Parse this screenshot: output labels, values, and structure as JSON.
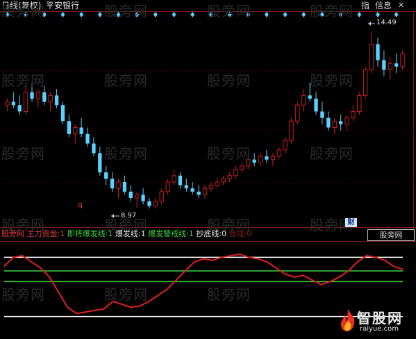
{
  "header": {
    "chart_type_label": "日线(复权)",
    "stock_name": "平安银行",
    "btn_guide": "指",
    "btn_info": "信息",
    "btn_close": "✕"
  },
  "annotations": {
    "high_label": "14.49",
    "low_label": "8.97",
    "q_marker": "q",
    "cai_marker": "财"
  },
  "indicator_legend": {
    "name": "股旁网",
    "items": [
      {
        "label": "主力资金:",
        "value": "1",
        "color": "#e23c3c"
      },
      {
        "label": "即将爆发线:",
        "value": "1",
        "color": "#3fd13f"
      },
      {
        "label": "爆发线:",
        "value": "1",
        "color": "#e8e8e8"
      },
      {
        "label": "爆发警戒线:",
        "value": "1",
        "color": "#3fd13f"
      },
      {
        "label": "抄底线:",
        "value": "0",
        "color": "#e8e8e8"
      },
      {
        "label": "合成:",
        "value": "0",
        "color": "#8a2020"
      }
    ]
  },
  "indicator_tab": "股旁网",
  "watermark_text": "股旁网",
  "logo": {
    "name": "智股网",
    "url": "raiyue.com"
  },
  "colors": {
    "up": "#c81e1e",
    "down": "#5ad2ff",
    "diamond": "#5ad2ff",
    "line_main": "#e02020",
    "line_white": "#ffffff",
    "line_green": "#3fd13f"
  },
  "chart_data": {
    "type": "candlestick",
    "high": 14.49,
    "low": 8.97,
    "ylim": [
      8.5,
      15.0
    ],
    "candles": [
      [
        12.2,
        12.4,
        12.0,
        12.3
      ],
      [
        12.3,
        12.6,
        12.1,
        12.2
      ],
      [
        12.2,
        12.5,
        11.9,
        12.0
      ],
      [
        12.0,
        12.8,
        11.9,
        12.6
      ],
      [
        12.6,
        12.9,
        12.3,
        12.4
      ],
      [
        12.4,
        12.7,
        12.1,
        12.6
      ],
      [
        12.6,
        12.8,
        12.2,
        12.3
      ],
      [
        12.3,
        12.6,
        12.0,
        12.5
      ],
      [
        12.5,
        12.7,
        12.1,
        12.2
      ],
      [
        12.2,
        12.3,
        11.6,
        11.7
      ],
      [
        11.7,
        11.9,
        11.2,
        11.3
      ],
      [
        11.3,
        11.6,
        11.0,
        11.5
      ],
      [
        11.5,
        11.8,
        11.2,
        11.3
      ],
      [
        11.3,
        11.5,
        10.9,
        11.0
      ],
      [
        11.0,
        11.2,
        10.6,
        10.7
      ],
      [
        10.7,
        10.9,
        10.0,
        10.1
      ],
      [
        10.1,
        10.3,
        9.7,
        9.9
      ],
      [
        9.9,
        10.1,
        9.5,
        9.6
      ],
      [
        9.6,
        9.9,
        9.3,
        9.8
      ],
      [
        9.8,
        10.0,
        9.4,
        9.5
      ],
      [
        9.5,
        9.7,
        9.2,
        9.3
      ],
      [
        9.3,
        9.5,
        9.0,
        9.4
      ],
      [
        9.4,
        9.6,
        9.1,
        9.2
      ],
      [
        9.2,
        9.3,
        8.97,
        9.05
      ],
      [
        9.05,
        9.3,
        8.97,
        9.2
      ],
      [
        9.2,
        9.6,
        9.1,
        9.5
      ],
      [
        9.5,
        9.9,
        9.4,
        9.8
      ],
      [
        9.8,
        10.2,
        9.7,
        10.0
      ],
      [
        10.0,
        10.1,
        9.6,
        9.7
      ],
      [
        9.7,
        9.9,
        9.5,
        9.6
      ],
      [
        9.6,
        9.8,
        9.4,
        9.5
      ],
      [
        9.5,
        9.7,
        9.3,
        9.4
      ],
      [
        9.4,
        9.7,
        9.3,
        9.6
      ],
      [
        9.6,
        9.8,
        9.5,
        9.7
      ],
      [
        9.7,
        9.9,
        9.6,
        9.8
      ],
      [
        9.8,
        10.0,
        9.7,
        9.9
      ],
      [
        9.9,
        10.1,
        9.8,
        10.0
      ],
      [
        10.0,
        10.3,
        9.9,
        10.2
      ],
      [
        10.2,
        10.4,
        10.1,
        10.3
      ],
      [
        10.3,
        10.6,
        10.2,
        10.5
      ],
      [
        10.5,
        10.7,
        10.3,
        10.4
      ],
      [
        10.4,
        10.7,
        10.3,
        10.6
      ],
      [
        10.6,
        10.8,
        10.4,
        10.5
      ],
      [
        10.5,
        10.7,
        10.3,
        10.6
      ],
      [
        10.6,
        10.9,
        10.5,
        10.8
      ],
      [
        10.8,
        11.2,
        10.7,
        11.1
      ],
      [
        11.1,
        11.8,
        11.0,
        11.7
      ],
      [
        11.7,
        12.3,
        11.6,
        12.2
      ],
      [
        12.2,
        12.7,
        12.0,
        12.5
      ],
      [
        12.5,
        12.9,
        12.3,
        12.4
      ],
      [
        12.4,
        12.6,
        11.9,
        12.0
      ],
      [
        12.0,
        12.3,
        11.6,
        11.8
      ],
      [
        11.8,
        12.0,
        11.4,
        11.5
      ],
      [
        11.5,
        11.8,
        11.3,
        11.7
      ],
      [
        11.7,
        11.9,
        11.4,
        11.6
      ],
      [
        11.6,
        11.9,
        11.4,
        11.8
      ],
      [
        11.8,
        12.2,
        11.7,
        12.0
      ],
      [
        12.0,
        12.6,
        11.9,
        12.5
      ],
      [
        12.5,
        13.4,
        12.4,
        13.3
      ],
      [
        13.3,
        14.49,
        13.2,
        14.1
      ],
      [
        14.1,
        14.3,
        13.4,
        13.6
      ],
      [
        13.6,
        13.9,
        13.1,
        13.3
      ],
      [
        13.3,
        13.7,
        13.0,
        13.5
      ],
      [
        13.5,
        13.8,
        13.2,
        13.4
      ],
      [
        13.4,
        13.9,
        13.3,
        13.8
      ]
    ],
    "indicator_series": [
      0.55,
      0.85,
      0.9,
      0.7,
      0.5,
      0.2,
      -0.3,
      -0.8,
      -1.0,
      -0.95,
      -0.9,
      -0.85,
      -0.6,
      -0.7,
      -0.8,
      -0.75,
      -0.6,
      -0.4,
      -0.2,
      0.1,
      0.4,
      0.7,
      0.8,
      0.75,
      0.85,
      0.9,
      0.95,
      0.85,
      0.8,
      0.7,
      0.5,
      0.3,
      0.2,
      0.25,
      0.1,
      -0.05,
      0.05,
      0.2,
      0.4,
      0.7,
      0.9,
      0.85,
      0.75,
      0.55,
      0.45
    ],
    "indicator_lines": {
      "white_upper": 0.85,
      "green_upper": 0.4,
      "green_lower": 0.05,
      "white_lower": -1.1
    }
  }
}
